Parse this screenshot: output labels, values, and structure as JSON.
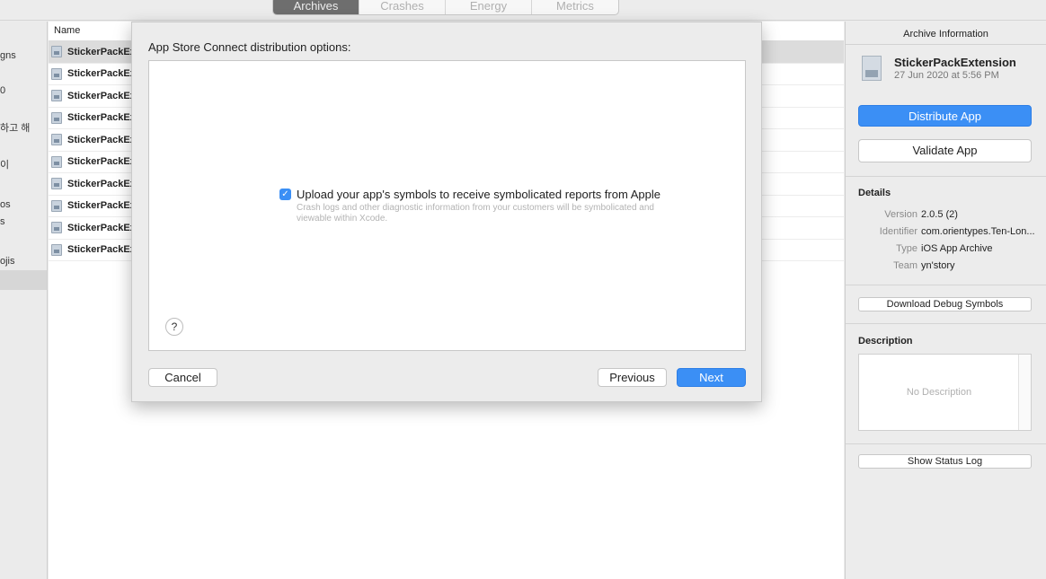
{
  "tabs": [
    "Archives",
    "Crashes",
    "Energy",
    "Metrics"
  ],
  "sidebar": {
    "items": [
      "gns",
      "0",
      "하고 해",
      "이",
      "os",
      "s",
      "ojis"
    ]
  },
  "list": {
    "column_name": "Name",
    "rows": [
      "StickerPackEx",
      "StickerPackEx",
      "StickerPackEx",
      "StickerPackEx",
      "StickerPackEx",
      "StickerPackEx",
      "StickerPackEx",
      "StickerPackEx",
      "StickerPackEx",
      "StickerPackEx"
    ]
  },
  "panel": {
    "title": "Archive Information",
    "archive_name": "StickerPackExtension",
    "archive_date": "27 Jun 2020 at 5:56 PM",
    "distribute_label": "Distribute App",
    "validate_label": "Validate App",
    "details_heading": "Details",
    "details": [
      {
        "key": "Version",
        "value": "2.0.5 (2)"
      },
      {
        "key": "Identifier",
        "value": "com.orientypes.Ten-Lon..."
      },
      {
        "key": "Type",
        "value": "iOS App Archive"
      },
      {
        "key": "Team",
        "value": "yn'story"
      }
    ],
    "download_symbols_label": "Download Debug Symbols",
    "description_heading": "Description",
    "description_placeholder": "No Description",
    "status_log_label": "Show Status Log"
  },
  "sheet": {
    "title": "App Store Connect distribution options:",
    "checkbox_label": "Upload your app's symbols to receive symbolicated reports from Apple",
    "checkbox_checked": true,
    "checkbox_help": "Crash logs and other diagnostic information from your customers will be symbolicated and viewable within Xcode.",
    "help_label": "?",
    "cancel_label": "Cancel",
    "previous_label": "Previous",
    "next_label": "Next"
  },
  "colors": {
    "accent": "#3b8ff5",
    "selected_tab": "#6e6e6e"
  }
}
